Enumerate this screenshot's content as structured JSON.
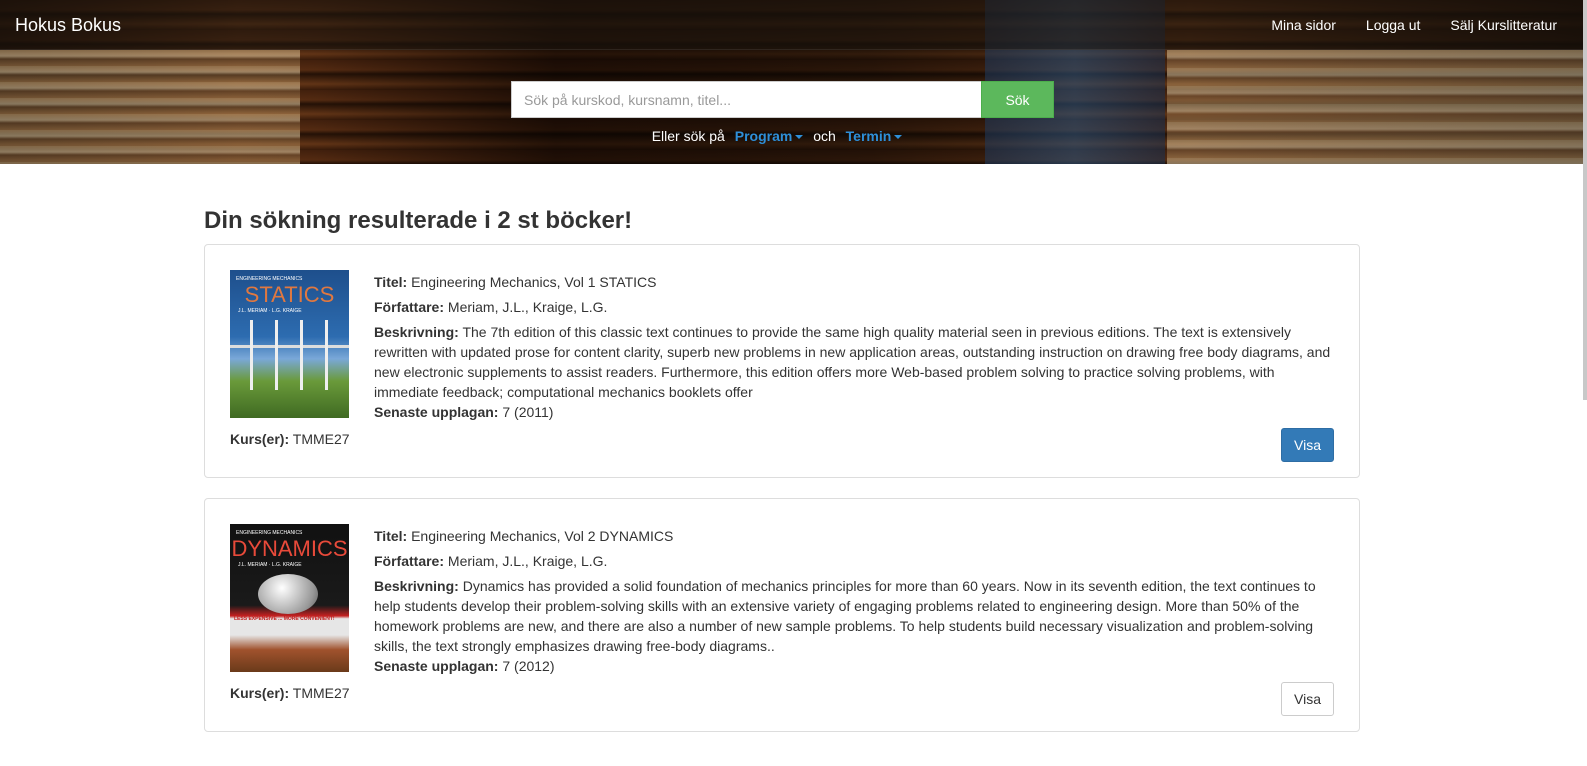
{
  "navbar": {
    "brand": "Hokus Bokus",
    "links": [
      "Mina sidor",
      "Logga ut",
      "Sälj Kurslitteratur"
    ]
  },
  "search": {
    "placeholder": "Sök på kurskod, kursnamn, titel...",
    "button_label": "Sök",
    "alt_prefix": "Eller sök på",
    "program_label": "Program",
    "connector": "och",
    "term_label": "Termin"
  },
  "results": {
    "heading": "Din sökning resulterade i 2 st böcker!",
    "labels": {
      "title": "Titel:",
      "author": "Författare:",
      "description": "Beskrivning:",
      "edition": "Senaste upplagan:",
      "courses": "Kurs(er):",
      "view": "Visa"
    },
    "books": [
      {
        "title": "Engineering Mechanics, Vol 1 STATICS",
        "author": "Meriam, J.L., Kraige, L.G.",
        "description": "The 7th edition of this classic text continues to provide the same high quality material seen in previous editions. The text is extensively rewritten with updated prose for content clarity, superb new problems in new application areas, outstanding instruction on drawing free body diagrams, and new electronic supplements to assist readers. Furthermore, this edition offers more Web-based problem solving to practice solving problems, with immediate feedback; computational mechanics booklets offer",
        "edition": "7 (2011)",
        "courses": "TMME27",
        "cover_title": "STATICS",
        "cover_series": "ENGINEERING MECHANICS",
        "cover_authors": "J.L. MERIAM · L.G. KRAIGE"
      },
      {
        "title": "Engineering Mechanics, Vol 2 DYNAMICS",
        "author": "Meriam, J.L., Kraige, L.G.",
        "description": "Dynamics has provided a solid foundation of mechanics principles for more than 60 years. Now in its seventh edition, the text continues to help students develop their problem-solving skills with an extensive variety of engaging problems related to engineering design. More than 50% of the homework problems are new, and there are also a number of new sample problems. To help students build necessary visualization and problem-solving skills, the text strongly emphasizes drawing free-body diagrams..",
        "edition": "7 (2012)",
        "courses": "TMME27",
        "cover_title": "DYNAMICS",
        "cover_series": "ENGINEERING MECHANICS",
        "cover_authors": "J.L. MERIAM · L.G. KRAIGE",
        "cover_banner": "LESS EXPENSIVE ... MORE CONVENIENT!"
      }
    ]
  },
  "colors": {
    "search_button": "#5cb85c",
    "dropdown_link": "#2e8fd8",
    "primary_button": "#337ab7"
  }
}
